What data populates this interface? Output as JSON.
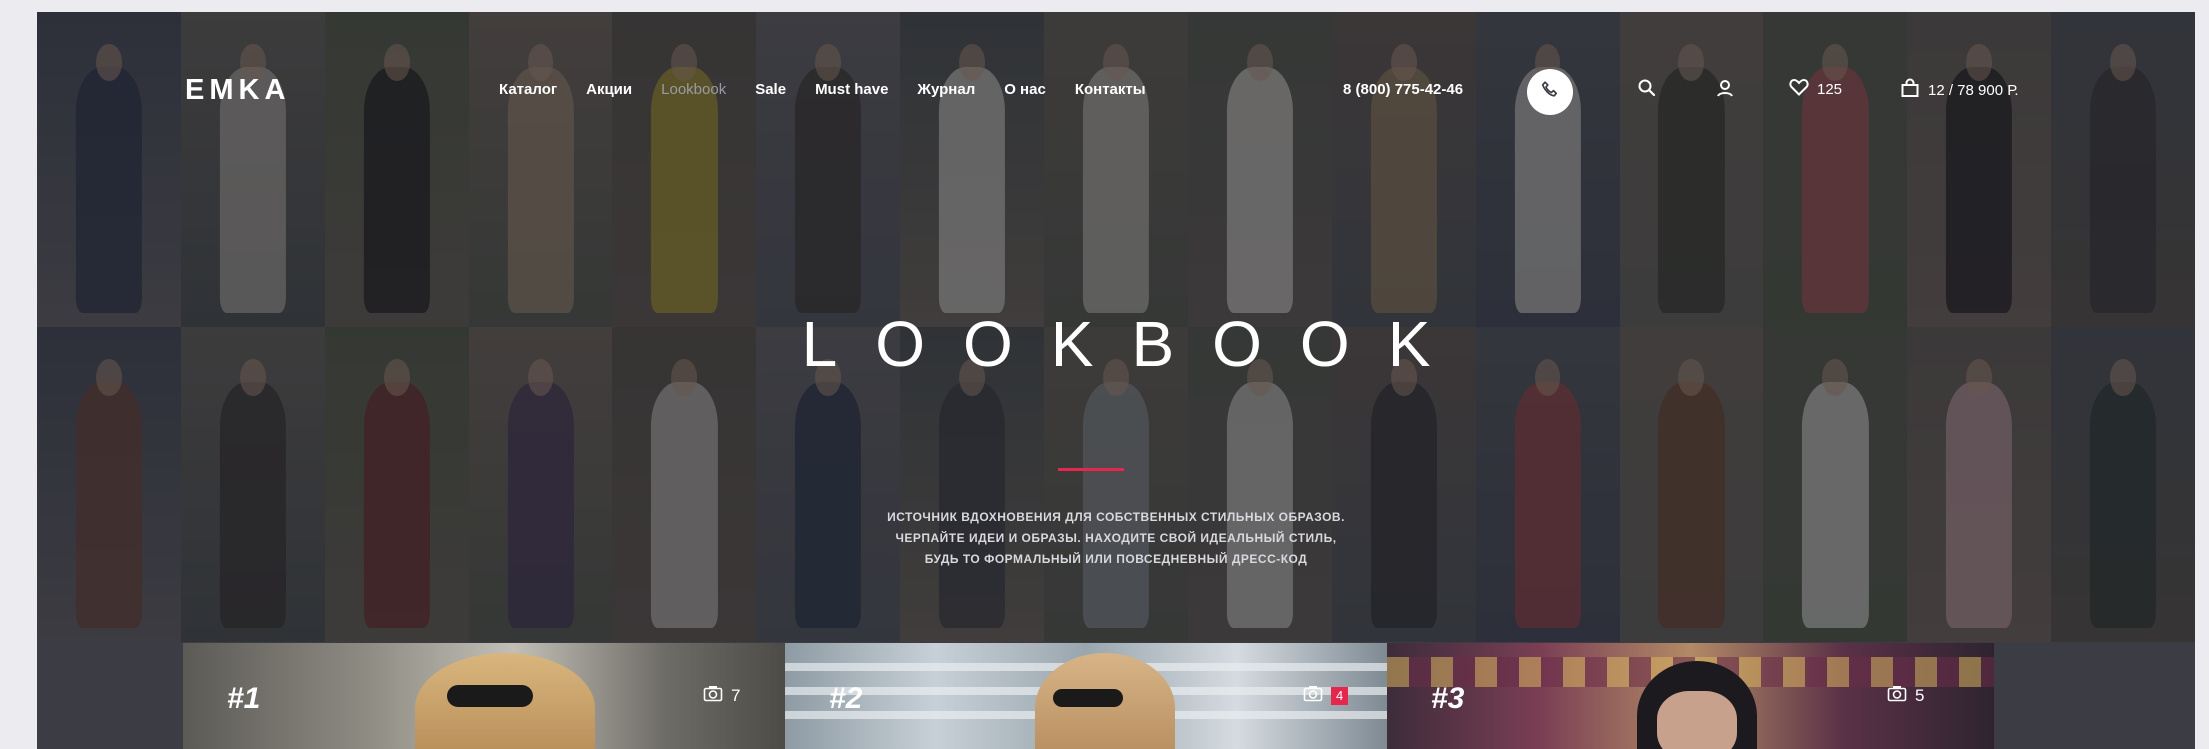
{
  "header": {
    "logo": "EMKA",
    "nav": [
      {
        "label": "Каталог",
        "active": false
      },
      {
        "label": "Акции",
        "active": false
      },
      {
        "label": "Lookbook",
        "active": true
      },
      {
        "label": "Sale",
        "active": false
      },
      {
        "label": "Must have",
        "active": false
      },
      {
        "label": "Журнал",
        "active": false
      },
      {
        "label": "О нас",
        "active": false
      },
      {
        "label": "Контакты",
        "active": false
      }
    ],
    "phone": "8 (800) 775-42-46",
    "favorites_count": "125",
    "cart_summary": "12 / 78 900 Р."
  },
  "hero": {
    "title": "LOOKBOOK",
    "subtitle_lines": [
      "ИСТОЧНИК ВДОХНОВЕНИЯ ДЛЯ СОБСТВЕННЫХ СТИЛЬНЫХ ОБРАЗОВ.",
      "ЧЕРПАЙТЕ ИДЕИ И ОБРАЗЫ. НАХОДИТЕ СВОЙ ИДЕАЛЬНЫЙ СТИЛЬ,",
      "БУДЬ ТО ФОРМАЛЬНЫЙ ИЛИ ПОВСЕДНЕВНЫЙ ДРЕСС-КОД"
    ]
  },
  "lookbook_cards": [
    {
      "number": "#1",
      "photo_count": "7",
      "highlight": false
    },
    {
      "number": "#2",
      "photo_count": "4",
      "highlight": true
    },
    {
      "number": "#3",
      "photo_count": "5",
      "highlight": false
    }
  ],
  "colors": {
    "accent": "#e4274c",
    "background": "#ecebf0",
    "text": "#ffffff",
    "nav_inactive": "#9a9aa6"
  }
}
